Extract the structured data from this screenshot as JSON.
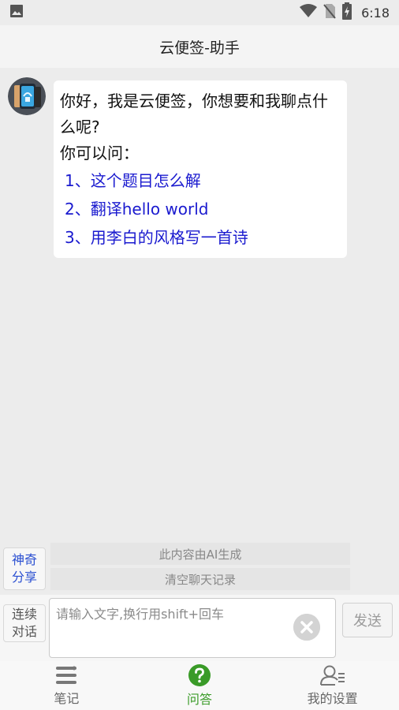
{
  "status_bar": {
    "time": "6:18",
    "icons": [
      "image-icon",
      "wifi-icon",
      "no-sim-icon",
      "battery-charging-icon"
    ]
  },
  "header": {
    "title": "云便签-助手"
  },
  "chat": {
    "messages": [
      {
        "sender": "assistant",
        "greeting": "你好，我是云便签，你想要和我聊点什么呢?",
        "prompt": "你可以问：",
        "suggestions": [
          "1、这个题目怎么解",
          "2、翻译hello world",
          "3、用李白的风格写一首诗"
        ]
      }
    ]
  },
  "actions": {
    "magic_share": "神奇分享",
    "ai_note": "此内容由AI生成",
    "clear_chat": "清空聊天记录"
  },
  "input_bar": {
    "continuous_label": "连续对话",
    "placeholder": "请输入文字,换行用shift+回车",
    "value": "",
    "send_label": "发送"
  },
  "tabs": [
    {
      "label": "笔记",
      "icon": "list-icon",
      "active": false
    },
    {
      "label": "问答",
      "icon": "question-icon",
      "active": true
    },
    {
      "label": "我的设置",
      "icon": "user-settings-icon",
      "active": false
    }
  ],
  "colors": {
    "background": "#ececec",
    "link_blue": "#1a1acf",
    "active_green": "#3a9b28",
    "magic_share_blue": "#2a4fd1"
  }
}
